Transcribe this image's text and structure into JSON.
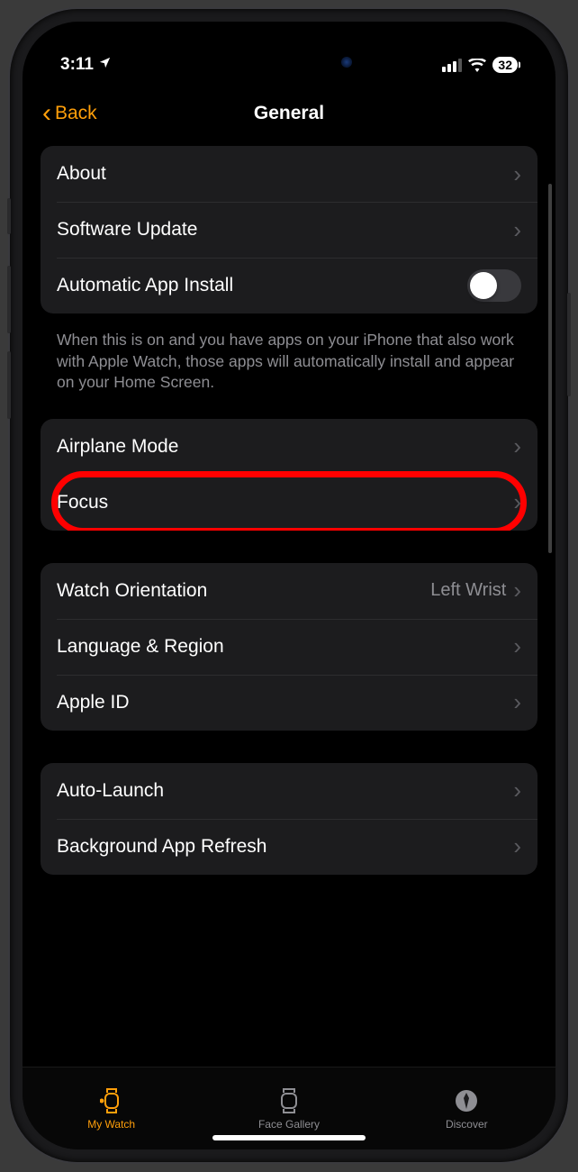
{
  "status": {
    "time": "3:11",
    "battery": "32"
  },
  "nav": {
    "back": "Back",
    "title": "General"
  },
  "group1": {
    "about": "About",
    "software_update": "Software Update",
    "auto_install": "Automatic App Install"
  },
  "footer1": "When this is on and you have apps on your iPhone that also work with Apple Watch, those apps will automatically install and appear on your Home Screen.",
  "group2": {
    "airplane": "Airplane Mode",
    "focus": "Focus"
  },
  "group3": {
    "orientation_label": "Watch Orientation",
    "orientation_value": "Left Wrist",
    "language": "Language & Region",
    "apple_id": "Apple ID"
  },
  "group4": {
    "auto_launch": "Auto-Launch",
    "bg_refresh": "Background App Refresh"
  },
  "tabs": {
    "my_watch": "My Watch",
    "face_gallery": "Face Gallery",
    "discover": "Discover"
  }
}
